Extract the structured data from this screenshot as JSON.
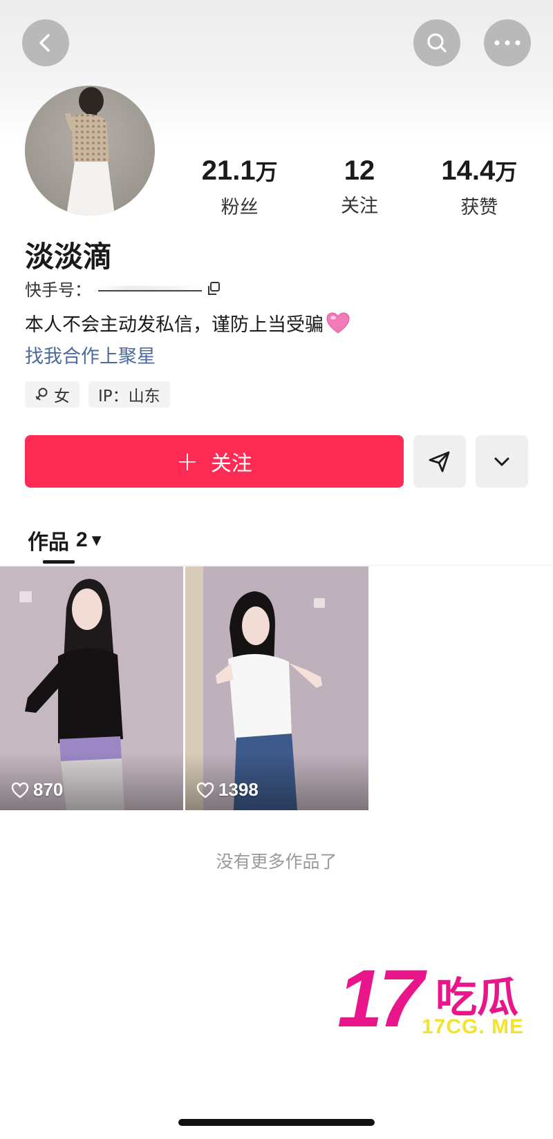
{
  "header": {
    "back_icon": "chevron-left-icon",
    "search_icon": "search-icon",
    "more_icon": "more-horizontal-icon"
  },
  "profile": {
    "name": "淡淡滴",
    "uid_label": "快手号：",
    "bio": "本人不会主动发私信，谨防上当受骗",
    "link": "找我合作上聚星",
    "tags": {
      "gender": "女",
      "ip": "IP：山东"
    }
  },
  "stats": {
    "fans": {
      "value": "21.1",
      "unit": "万",
      "label": "粉丝"
    },
    "following": {
      "value": "12",
      "label": "关注"
    },
    "likes": {
      "value": "14.4",
      "unit": "万",
      "label": "获赞"
    }
  },
  "actions": {
    "follow_plus": "+",
    "follow_label": "关注"
  },
  "works_tab": {
    "label": "作品",
    "count": "2",
    "caret": "▼"
  },
  "works": [
    {
      "likes": "870"
    },
    {
      "likes": "1398"
    }
  ],
  "end_text": "没有更多作品了",
  "watermark": {
    "number": "17",
    "chinese": "吃瓜",
    "url": "17CG. ME"
  },
  "colors": {
    "accent": "#fe2c55",
    "link": "#4c6a9e",
    "watermark": "#e8168a",
    "watermark_url": "#f4e230"
  }
}
